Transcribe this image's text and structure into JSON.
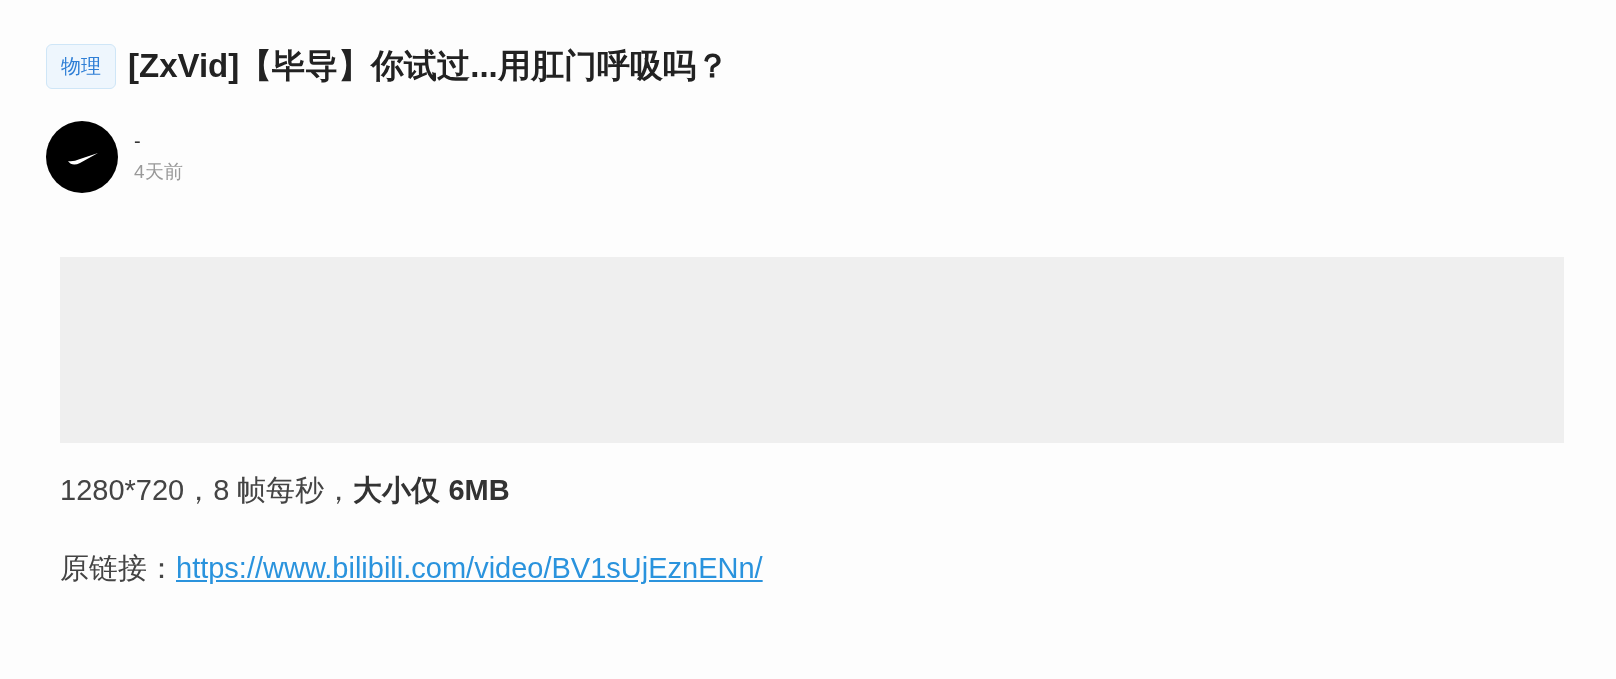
{
  "post": {
    "tag": "物理",
    "title": "[ZxVid]【毕导】你试过...用肛门呼吸吗？"
  },
  "author": {
    "name": "-",
    "time": "4天前"
  },
  "video": {
    "kind": "placeholder"
  },
  "body": {
    "spec": "1280*720，8 帧每秒，**大小仅 6MB**",
    "link_label": "原链接：",
    "link": "https://www.bilibili.com/video/BV1sUjEznENn/"
  }
}
